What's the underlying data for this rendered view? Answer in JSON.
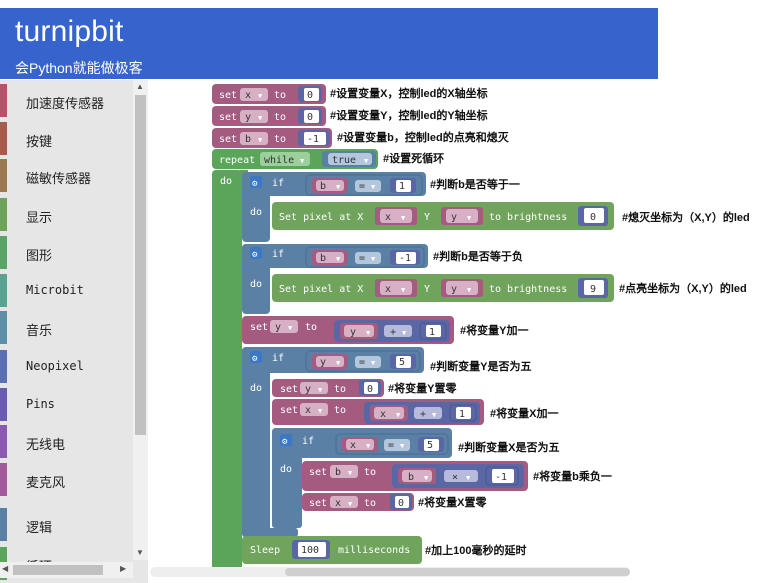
{
  "header": {
    "title": "turnipbit",
    "subtitle": "会Python就能做极客"
  },
  "toolbox": {
    "categories": [
      {
        "label": "加速度传感器",
        "color": "#b5526a"
      },
      {
        "label": "按键",
        "color": "#a65c4a"
      },
      {
        "label": "磁敏传感器",
        "color": "#9c7a4f"
      },
      {
        "label": "显示",
        "color": "#6ea35a"
      },
      {
        "label": "图形",
        "color": "#5aa46a"
      },
      {
        "label": "Microbit",
        "color": "#5aa392"
      },
      {
        "label": "音乐",
        "color": "#5a8fa5"
      },
      {
        "label": "Neopixel",
        "color": "#5b6fb0"
      },
      {
        "label": "Pins",
        "color": "#6a5ab0"
      },
      {
        "label": "无线电",
        "color": "#8a5ab0"
      },
      {
        "label": "麦克风",
        "color": "#a35a9c"
      },
      {
        "label": "逻辑",
        "color": "#5b80a5"
      },
      {
        "label": "循环",
        "color": "#5ba55b"
      }
    ]
  },
  "blocks": {
    "set_x": {
      "kw_set": "set",
      "var": "x",
      "kw_to": "to",
      "num": "0",
      "comment": "#设置变量X，控制led的X轴坐标"
    },
    "set_y": {
      "kw_set": "set",
      "var": "y",
      "kw_to": "to",
      "num": "0",
      "comment": "#设置变量Y，控制led的Y轴坐标"
    },
    "set_b": {
      "kw_set": "set",
      "var": "b",
      "kw_to": "to",
      "num": "-1",
      "comment": "#设置变量b，控制led的点亮和熄灭"
    },
    "repeat": {
      "kw_repeat": "repeat",
      "mode": "while",
      "cond": "true",
      "kw_do": "do",
      "comment": "#设置死循环"
    },
    "if1": {
      "kw_if": "if",
      "var": "b",
      "op": "=",
      "num": "1",
      "comment": "#判断b是否等于一",
      "kw_do": "do"
    },
    "pix1": {
      "text": "Set pixel at X",
      "xv": "x",
      "ylabel": "Y",
      "yv": "y",
      "tb": "to brightness",
      "num": "0",
      "comment": "#熄灭坐标为（X,Y）的led"
    },
    "if2": {
      "kw_if": "if",
      "var": "b",
      "op": "=",
      "num": "-1",
      "comment": "#判断b是否等于负",
      "kw_do": "do"
    },
    "pix2": {
      "text": "Set pixel at X",
      "xv": "x",
      "ylabel": "Y",
      "yv": "y",
      "tb": "to brightness",
      "num": "9",
      "comment": "#点亮坐标为（X,Y）的led"
    },
    "set_y_inc": {
      "kw_set": "set",
      "var": "y",
      "kw_to": "to",
      "a": "y",
      "op": "+",
      "num": "1",
      "comment": "#将变量Y加一"
    },
    "if3": {
      "kw_if": "if",
      "var": "y",
      "op": "=",
      "num": "5",
      "comment": "#判断变量Y是否为五",
      "kw_do": "do"
    },
    "set_y0": {
      "kw_set": "set",
      "var": "y",
      "kw_to": "to",
      "num": "0",
      "comment": "#将变量Y置零"
    },
    "set_x_inc": {
      "kw_set": "set",
      "var": "x",
      "kw_to": "to",
      "a": "x",
      "op": "+",
      "num": "1",
      "comment": "#将变量X加一"
    },
    "if4": {
      "kw_if": "if",
      "var": "x",
      "op": "=",
      "num": "5",
      "comment": "#判断变量X是否为五",
      "kw_do": "do"
    },
    "set_b_neg": {
      "kw_set": "set",
      "var": "b",
      "kw_to": "to",
      "a": "b",
      "op": "×",
      "num": "-1",
      "comment": "#将变量b乘负一"
    },
    "set_x0": {
      "kw_set": "set",
      "var": "x",
      "kw_to": "to",
      "num": "0",
      "comment": "#将变量X置零"
    },
    "sleep": {
      "kw_sleep": "Sleep",
      "num": "100",
      "unit": "milliseconds",
      "comment": "#加上100毫秒的延时"
    }
  },
  "colors": {
    "variables": "#a55b80",
    "logic": "#5b80a5",
    "loops": "#5ba55b",
    "math": "#5b67a5",
    "display": "#70a35c",
    "header": "#3763cc"
  }
}
